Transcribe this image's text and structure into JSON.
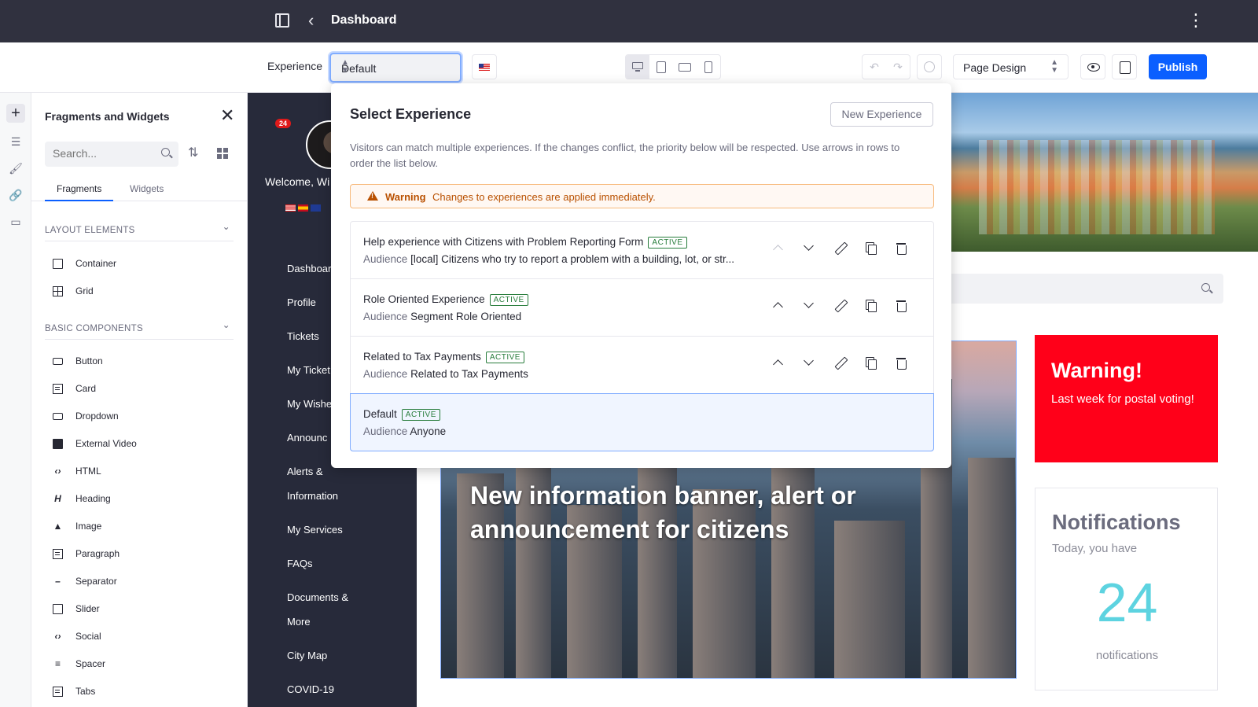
{
  "topbar": {
    "title": "Dashboard"
  },
  "toolbar": {
    "experience_label": "Experience",
    "experience_value": "Default",
    "page_design_value": "Page Design",
    "publish_label": "Publish"
  },
  "fragments_panel": {
    "title": "Fragments and Widgets",
    "search_placeholder": "Search...",
    "tabs": [
      "Fragments",
      "Widgets"
    ],
    "sections": [
      {
        "title": "LAYOUT ELEMENTS",
        "items": [
          "Container",
          "Grid"
        ]
      },
      {
        "title": "BASIC COMPONENTS",
        "items": [
          "Button",
          "Card",
          "Dropdown",
          "External Video",
          "HTML",
          "Heading",
          "Image",
          "Paragraph",
          "Separator",
          "Slider",
          "Social",
          "Spacer",
          "Tabs"
        ]
      }
    ]
  },
  "site": {
    "badge_count": "24",
    "welcome": "Welcome, Wi",
    "nav": [
      "Dashboar",
      "Profile",
      "Tickets",
      "My Ticket",
      "My Wishe",
      "Announc",
      "Alerts &",
      "Information",
      "My Services",
      "FAQs",
      "Documents &",
      "More",
      "City Map",
      "COVID-19"
    ],
    "banner_text": "New information banner, alert or announcement for citizens",
    "warning_card": {
      "title": "Warning!",
      "text": "Last week for postal voting!"
    },
    "notifications_card": {
      "title": "Notifications",
      "subtitle": "Today, you have",
      "count": "24",
      "label": "notifications"
    }
  },
  "popover": {
    "title": "Select Experience",
    "new_button": "New Experience",
    "description": "Visitors can match multiple experiences. If the changes conflict, the priority below will be respected. Use arrows in rows to order the list below.",
    "warning_label": "Warning",
    "warning_text": "Changes to experiences are applied immediately.",
    "audience_label": "Audience",
    "active_label": "ACTIVE",
    "experiences": [
      {
        "name": "Help experience with Citizens with Problem Reporting Form",
        "status": "ACTIVE",
        "audience": "[local] Citizens who try to report a problem with a building, lot, or str..."
      },
      {
        "name": "Role Oriented Experience",
        "status": "ACTIVE",
        "audience": "Segment Role Oriented"
      },
      {
        "name": "Related to Tax Payments",
        "status": "ACTIVE",
        "audience": "Related to Tax Payments"
      },
      {
        "name": "Default",
        "status": "ACTIVE",
        "audience": "Anyone"
      }
    ]
  }
}
